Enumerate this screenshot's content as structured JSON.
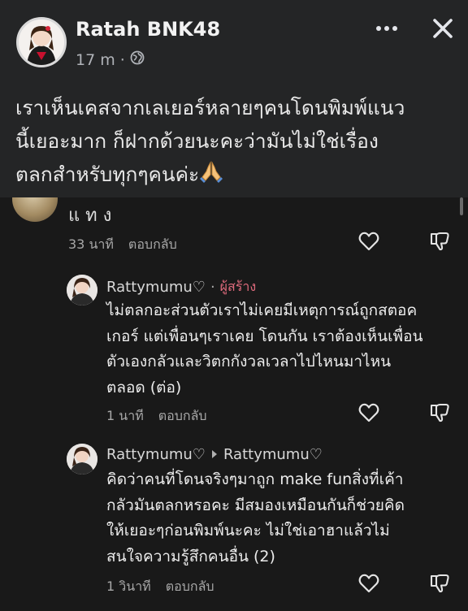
{
  "post": {
    "author": "Ratah BNK48",
    "time": "17 m",
    "separator": "·",
    "text_lines": [
      "เราเห็นเคสจากเลเยอร์หลายๆคนโดนพิมพ์แนว",
      "นี้เยอะมาก ก็ฝากด้วยนะคะว่ามันไม่ใช่เรื่อง",
      "ตลกสำหรับทุกๆคนค่ะ"
    ],
    "emoji": "🙏"
  },
  "previous_comment": {
    "text": "แทง",
    "time": "33 นาที",
    "reply_label": "ตอบกลับ"
  },
  "replies": [
    {
      "name": "Rattymumu♡",
      "dot": "·",
      "badge": "ผู้สร้าง",
      "lines": [
        "ไม่ตลกอะส่วนตัวเราไม่เคยมีเหตุการณ์ถูกสตอค",
        "เกอร์ แต่เพื่อนๆเราเคย โดนกัน เราต้องเห็นเพื่อน",
        "ตัวเองกลัวและวิตกกังวลเวลาไปไหนมาไหน",
        "ตลอด (ต่อ)"
      ],
      "time": "1 นาที",
      "reply_label": "ตอบกลับ"
    },
    {
      "name": "Rattymumu♡",
      "reply_to": "Rattymumu♡",
      "lines": [
        "คิดว่าคนที่โดนจริงๆมาถูก make funสิ่งที่เค้า",
        "กลัวมันตลกหรอคะ มีสมองเหมือนกันก็ช่วยคิด",
        "ให้เยอะๆก่อนพิมพ์นะคะ ไม่ใช่เอาฮาแล้วไม่",
        "สนใจความรู้สึกคนอื่น (2)"
      ],
      "time": "1 วินาที",
      "reply_label": "ตอบกลับ"
    }
  ],
  "colors": {
    "post_bg": "#242526",
    "comments_bg": "#191919",
    "creator_badge": "#e06b7d"
  }
}
